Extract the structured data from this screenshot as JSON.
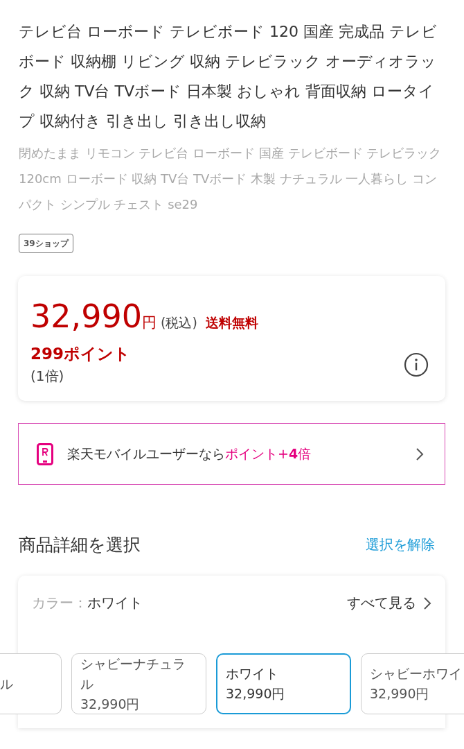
{
  "title": "テレビ台 ローボード テレビボード 120 国産 完成品 テレビボード 収納棚 リビング 収納 テレビラック オーディオラック 収納 TV台 TVボード 日本製 おしゃれ 背面収納 ロータイプ 収納付き 引き出し 引き出し収納",
  "subtitle": "閉めたまま リモコン テレビ台 ローボード 国産 テレビボード テレビラック 120cm ローボード 収納 TV台 TVボード 木製 ナチュラル 一人暮らし コンパクト シンプル チェスト se29",
  "shop_tag": "39ショップ",
  "price": {
    "amount": "32,990",
    "currency": "円",
    "tax": "(税込)",
    "shipping": "送料無料",
    "points": "299ポイント",
    "multiplier": "(1倍)"
  },
  "mobile_banner": {
    "text": "楽天モバイルユーザーなら",
    "highlight": "ポイント+**4**倍"
  },
  "options": {
    "heading": "商品詳細を選択",
    "clear": "選択を解除",
    "label": "カラー：",
    "current": "ホワイト",
    "see_all": "すべて見る",
    "items": [
      {
        "name": "ル",
        "selected": false
      },
      {
        "name": "シャビーナチュラル",
        "price": "32,990円",
        "selected": false
      },
      {
        "name": "ホワイト",
        "price": "32,990円",
        "selected": true
      },
      {
        "name": "シャビーホワイ",
        "price": "32,990円",
        "selected": false
      }
    ]
  }
}
